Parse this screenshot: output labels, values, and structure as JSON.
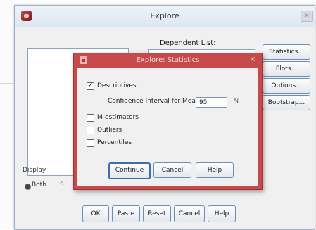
{
  "explore": {
    "title": "Explore",
    "dependent_list_label": "Dependent List:",
    "side_buttons": [
      "Statistics...",
      "Plots...",
      "Options...",
      "Bootstrap..."
    ],
    "display_label": "Display",
    "display_option_both": "Both",
    "stray_mark": "S",
    "bottom_buttons": [
      "OK",
      "Paste",
      "Reset",
      "Cancel",
      "Help"
    ]
  },
  "statistics_dialog": {
    "title": "Explore: Statistics",
    "close_glyph": "×",
    "descriptives_label": "Descriptives",
    "descriptives_checked": true,
    "confidence_label": "Confidence Interval for Mean:",
    "confidence_value": "95",
    "percent_sign": "%",
    "options": [
      {
        "label": "M-estimators",
        "checked": false
      },
      {
        "label": "Outliers",
        "checked": false
      },
      {
        "label": "Percentiles",
        "checked": false
      }
    ],
    "buttons": [
      "Continue",
      "Cancel",
      "Help"
    ]
  },
  "colors": {
    "dialog_frame": "#c74a4a",
    "button_border": "#6e8fb4",
    "window_bg": "#f0f0f0"
  },
  "icons": {
    "app": "spss-app-icon",
    "close": "close-icon",
    "check": "checkmark-icon"
  }
}
